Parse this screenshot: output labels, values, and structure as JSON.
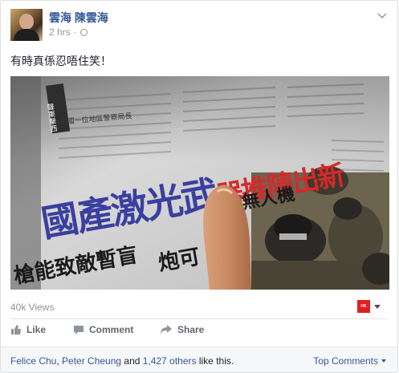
{
  "post": {
    "author": "雲海 陳雲海",
    "time": "2 hrs",
    "separator": "·",
    "text": "有時真係忍唔住笑！"
  },
  "video": {
    "headline": "國產激光武器推陳出新",
    "subline_left": "槍能致敵暫盲",
    "subline_right": "炮可",
    "subline_far": "無人機",
    "side_tag": "聲東擊西",
    "small_heading": "美國一位地區警察局長"
  },
  "stats": {
    "views": "40k Views",
    "logo_text": "HK"
  },
  "actions": {
    "like": "Like",
    "comment": "Comment",
    "share": "Share"
  },
  "footer": {
    "name1": "Felice Chu",
    "sep1": ", ",
    "name2": "Peter Cheung",
    "and": " and ",
    "others": "1,427 others",
    "tail": " like this.",
    "top_comments": "Top Comments"
  },
  "colors": {
    "link": "#365899",
    "muted": "#90949c",
    "headline_blue": "#3a3fa0",
    "headline_red": "#d42a2a"
  }
}
